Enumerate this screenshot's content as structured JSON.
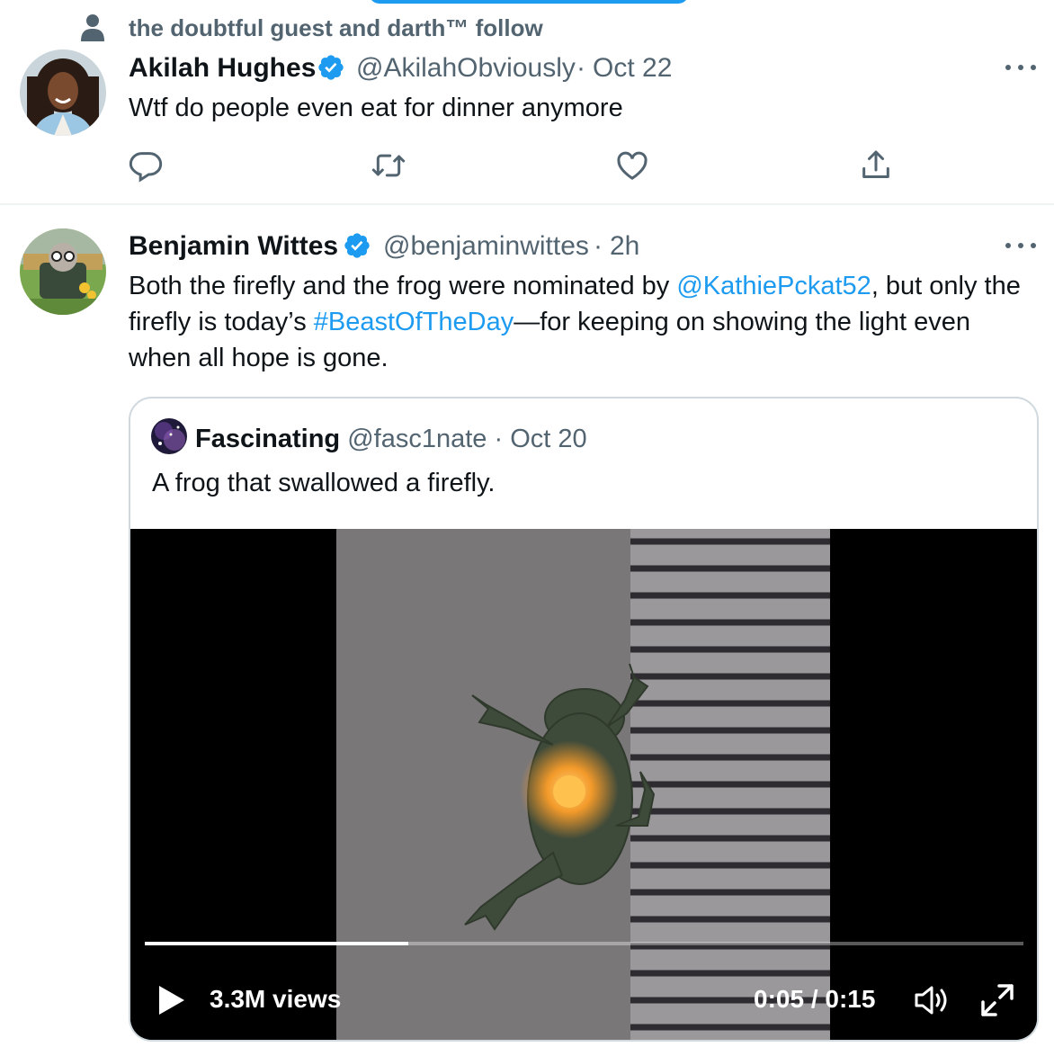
{
  "context": {
    "social_text": "the doubtful guest and darth™ follow"
  },
  "tweets": [
    {
      "name": "Akilah Hughes",
      "handle": "@AkilahObviously",
      "sep": "·",
      "time": "Oct 22",
      "text": "Wtf do people even eat for dinner anymore",
      "verified": true
    },
    {
      "name": "Benjamin Wittes",
      "handle": "@benjaminwittes",
      "sep": "·",
      "time": "2h",
      "verified": true,
      "text_parts": {
        "p1": "Both the firefly and the frog were nominated by ",
        "mention": "@KathiePckat52",
        "p2": ", but only the firefly is today’s ",
        "hashtag": "#BeastOfTheDay",
        "p3": "—for keeping on showing the light even when all hope is gone."
      }
    }
  ],
  "quote": {
    "name": "Fascinating",
    "handle": "@fasc1nate",
    "sep": "·",
    "time": "Oct 20",
    "text": "A frog that swallowed a firefly."
  },
  "video": {
    "views": "3.3M views",
    "time_display": "0:05 / 0:15",
    "progress": 0.3
  },
  "icons": [
    "person-icon",
    "verified-icon",
    "more-icon",
    "reply-icon",
    "retweet-icon",
    "like-icon",
    "share-icon",
    "play-icon",
    "volume-icon",
    "fullscreen-icon"
  ],
  "colors": {
    "accent": "#1d9bf0",
    "secondary_text": "#536471",
    "border": "#cfd9de"
  }
}
